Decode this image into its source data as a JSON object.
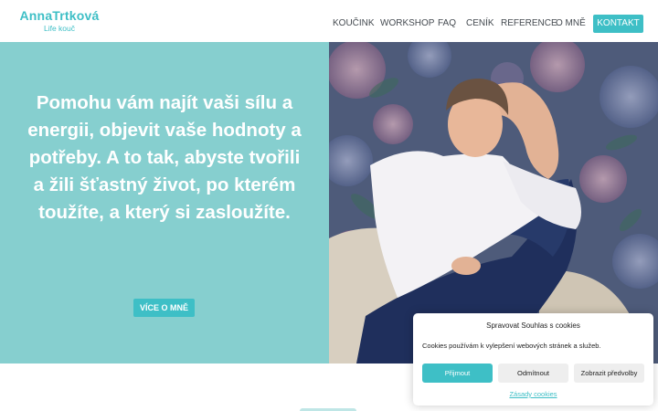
{
  "brand": {
    "name": "AnnaTrtková",
    "tagline": "Life kouč",
    "accent_color": "#3ebfc6"
  },
  "nav": {
    "items": [
      "KOUČINK",
      "WORKSHOP",
      "FAQ",
      "CENÍK",
      "REFERENCE",
      "O MNĚ"
    ],
    "cta": "KONTAKT"
  },
  "hero": {
    "headline": "Pomohu vám najít vaši sílu a energii, objevit vaše hodnoty a potřeby. A to tak, abyste tvořili a žili šťastný život, po kterém toužíte, a který si zasloužíte.",
    "button": "VÍCE O MNĚ",
    "background_color": "#86cfcf"
  },
  "cookie_banner": {
    "title": "Spravovat Souhlas s cookies",
    "message": "Cookies používám k vylepšení webových stránek a služeb.",
    "accept": "Přijmout",
    "deny": "Odmítnout",
    "preferences": "Zobrazit předvolby",
    "policy_link": "Zásady cookies"
  }
}
